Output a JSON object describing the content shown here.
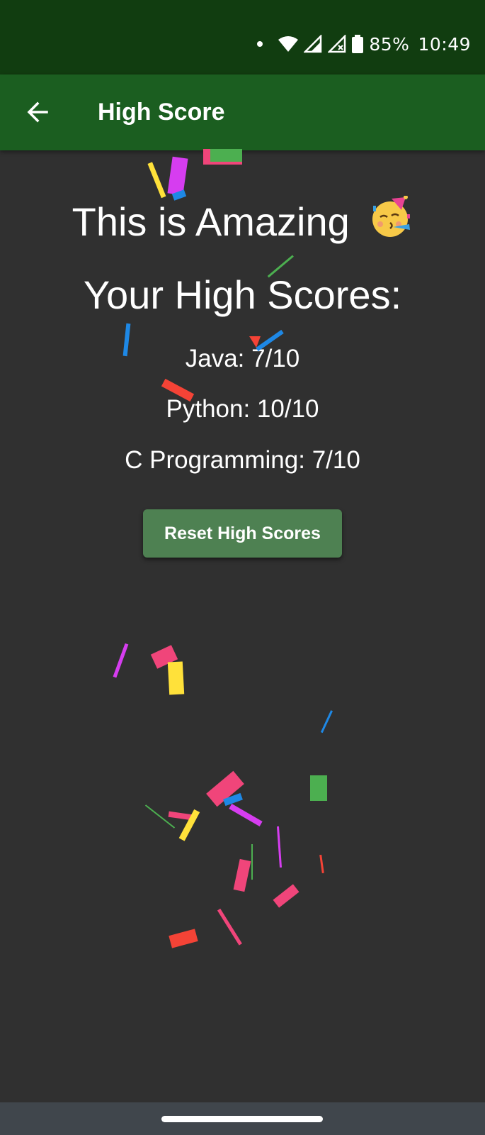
{
  "status_bar": {
    "battery": "85%",
    "time": "10:49",
    "icons": [
      "notification-dot-icon",
      "wifi-icon",
      "signal-icon",
      "signal-no-data-icon",
      "battery-icon"
    ]
  },
  "app_bar": {
    "title": "High Score",
    "back_icon": "arrow-back-icon"
  },
  "main": {
    "heading": "This is Amazing",
    "heading_emoji": "partying-face-icon",
    "subheading": "Your High Scores:",
    "scores": [
      "Java: 7/10",
      "Python: 10/10",
      "C Programming: 7/10"
    ],
    "reset_button_label": "Reset High Scores"
  },
  "colors": {
    "status_bar": "#113d10",
    "app_bar": "#1b5e20",
    "background": "#303030",
    "button": "#4e8152",
    "nav_bar": "#40464c"
  }
}
